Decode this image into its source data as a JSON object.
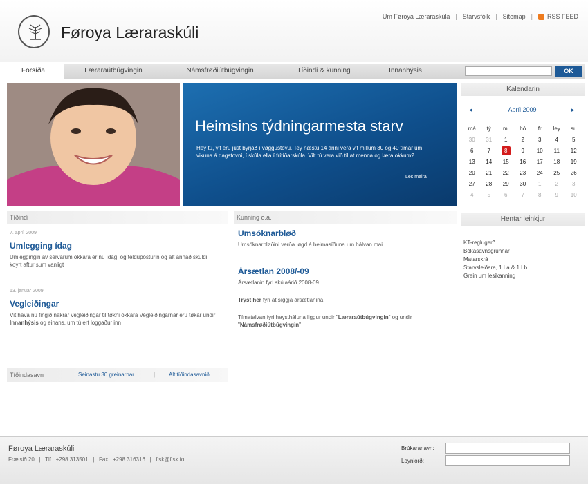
{
  "site": {
    "title": "Føroya Læraraskúli"
  },
  "toplinks": [
    "Um Føroya Læraraskúla",
    "Starvsfólk",
    "Sitemap"
  ],
  "rss_label": "RSS FEED",
  "nav": {
    "tabs": [
      "Forsíða",
      "Læraraútbúgvingin",
      "Námsfrøðiútbúgvingin",
      "Tíðindi & kunning",
      "Innanhýsis"
    ]
  },
  "search": {
    "button_label": "OK",
    "value": ""
  },
  "hero": {
    "title": "Heimsins týdningarmesta starv",
    "text": "Hey tú, vit eru júst byrjað í vøggustovu. Tey næstu 14 árini vera vit millum 30 og 40 tímar um vikuna á dagstovni, í skúla ella í frítíðarskúla. Vilt tú vera við til at menna og læra okkum?",
    "link": "Les meira"
  },
  "news": {
    "header": "Tíðindi",
    "items": [
      {
        "date": "7. apríl 2009",
        "title": "Umlegging ídag",
        "text": "Umleggingin av servarum okkara er nú ídag, og teldupósturin og alt annað skuldi koyrt aftur sum vanligt"
      },
      {
        "date": "13. januar 2009",
        "title": "Vegleiðingar",
        "text_a": "Vit hava nú fingið nakrar vegleiðingar til tøkni okkara Vegleiðingarnar eru tøkar undir ",
        "text_bold": "Innanhýsis",
        "text_b": " og einans, um tú ert loggaður inn"
      }
    ]
  },
  "archive": {
    "label": "Tíðindasavn",
    "link1": "Seinastu 30 greinarnar",
    "separator": "|",
    "link2": "Alt tíðindasavnið"
  },
  "kunning": {
    "header": "Kunning o.a.",
    "item1": {
      "title": "Umsóknarbløð",
      "text": "Umsóknarbløðini verða løgd á heimasíðuna um hálvan mai"
    },
    "item2": {
      "title": "Ársætlan 2008/-09",
      "text": "Ársætlanin fyri skúlaárið 2008-09",
      "line2_bold": "Trýst her",
      "line2_rest": " fyri at síggja ársætlanina",
      "line3_a": "Tímatalvan fyri heystháluna liggur undir \"",
      "line3_b1": "Læraraútbúgvingin",
      "line3_c": "\" og undir \"",
      "line3_b2": "Námsfrøðiútbúgvingin",
      "line3_d": "\""
    }
  },
  "calendar": {
    "header": "Kalendarin",
    "month": "Apríl 2009",
    "prev": "◂",
    "next": "▸",
    "weekdays": [
      "má",
      "tý",
      "mi",
      "hó",
      "fr",
      "ley",
      "su"
    ],
    "weeks": [
      [
        "30",
        "31",
        "1",
        "2",
        "3",
        "4",
        "5"
      ],
      [
        "6",
        "7",
        "8",
        "9",
        "10",
        "11",
        "12"
      ],
      [
        "13",
        "14",
        "15",
        "16",
        "17",
        "18",
        "19"
      ],
      [
        "20",
        "21",
        "22",
        "23",
        "24",
        "25",
        "26"
      ],
      [
        "27",
        "28",
        "29",
        "30",
        "1",
        "2",
        "3"
      ],
      [
        "4",
        "5",
        "6",
        "7",
        "8",
        "9",
        "10"
      ]
    ],
    "today": "8"
  },
  "links": {
    "header": "Hentar leinkjur",
    "items": [
      "KT-reglugerð",
      "Bókasavnsgrunnar",
      "Matarskrá",
      "Starvsleiðara, 1.La & 1.Lb",
      "Grein um lesikanning"
    ]
  },
  "footer": {
    "title": "Føroya Læraraskúli",
    "contact": "Frælsið 20   |   Tlf.  +298 313501   |   Fax.  +298 316316   |   flsk@flsk.fo",
    "user_label": "Brúkaranavn:",
    "pass_label": "Loyniorð:"
  },
  "colors": {
    "brand_blue": "#1e5a97",
    "today_red": "#d31b1b",
    "rss_orange": "#ee7b1e"
  }
}
